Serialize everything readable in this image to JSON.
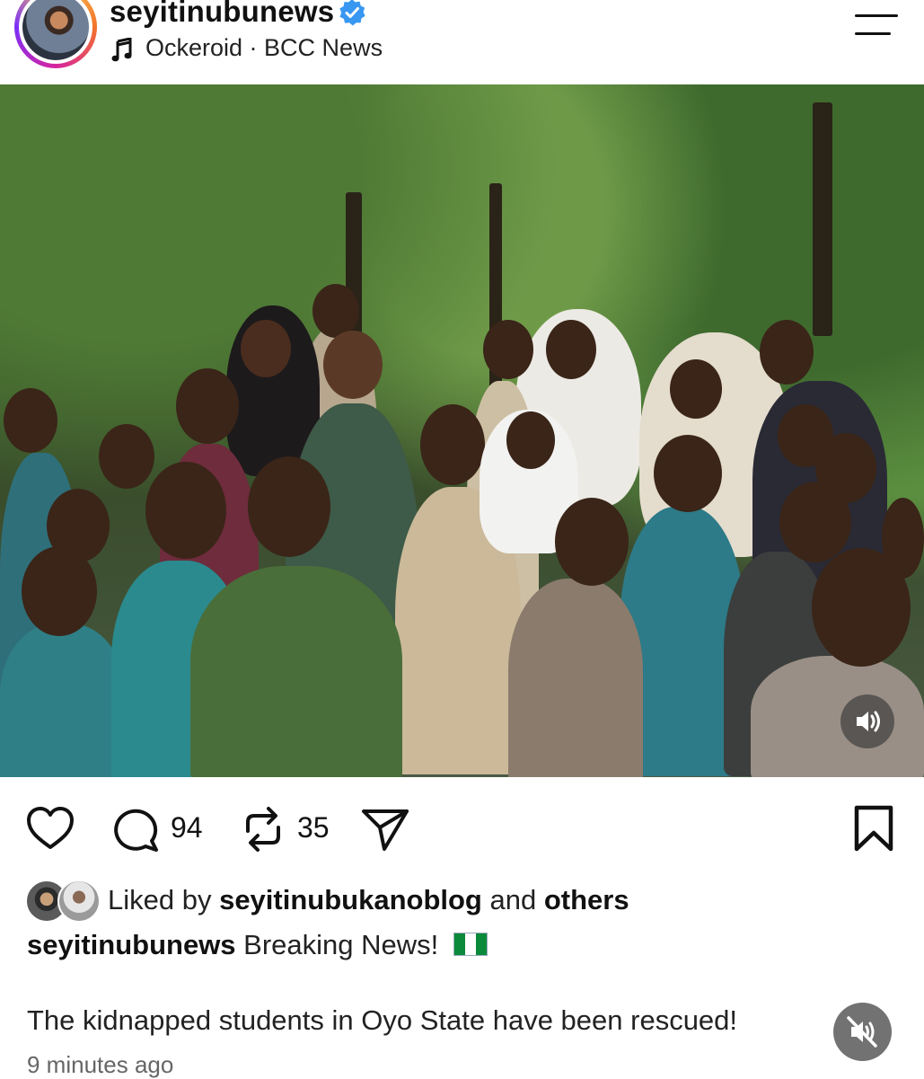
{
  "header": {
    "username": "seyitinubunews",
    "verified": true,
    "audio_artist": "Ockeroid",
    "audio_separator": " · ",
    "audio_title": "BCC News",
    "icons": {
      "music": "music-note-icon",
      "menu": "menu-icon",
      "verified": "verified-badge-icon"
    }
  },
  "post": {
    "media_type": "photo",
    "sound_icon": "speaker-icon"
  },
  "actions": {
    "comment_count": "94",
    "repost_count": "35",
    "icons": [
      "heart-icon",
      "comment-icon",
      "repost-icon",
      "share-icon",
      "bookmark-icon"
    ]
  },
  "likes": {
    "prefix": "Liked by ",
    "liker": "seyitinubukanoblog",
    "middle": " and ",
    "suffix": "others"
  },
  "caption": {
    "username": "seyitinubunews",
    "text": " Breaking News! ",
    "flag": "Nigeria flag",
    "body": "The kidnapped students in Oyo State have been rescued!"
  },
  "timestamp": "9 minutes ago",
  "mute_icon": "muted-speaker-icon",
  "colors": {
    "verified": "#3897f0",
    "text": "#111111",
    "muted": "#666666"
  }
}
